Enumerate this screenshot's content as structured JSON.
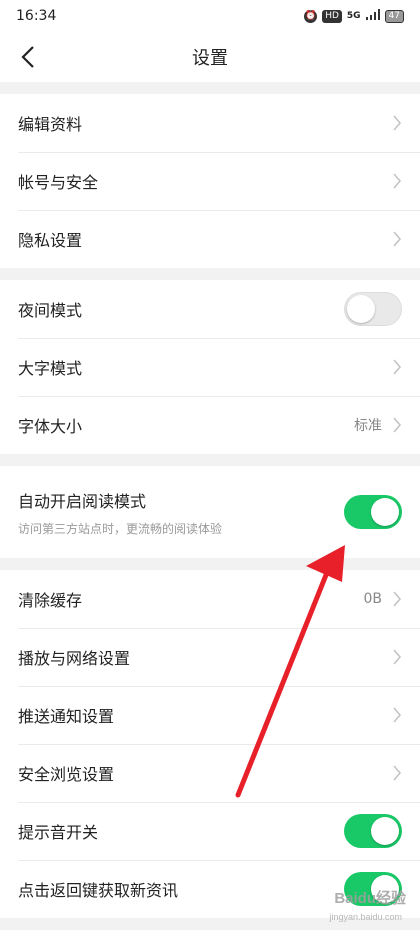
{
  "status_bar": {
    "time": "16:34",
    "hd": "HD",
    "network": "5G",
    "battery": "47"
  },
  "header": {
    "title": "设置"
  },
  "group1": [
    {
      "label": "编辑资料"
    },
    {
      "label": "帐号与安全"
    },
    {
      "label": "隐私设置"
    }
  ],
  "group2": {
    "night_mode": {
      "label": "夜间模式",
      "enabled": false
    },
    "large_font_mode": {
      "label": "大字模式"
    },
    "font_size": {
      "label": "字体大小",
      "value": "标准"
    }
  },
  "group3": {
    "auto_reading_mode": {
      "label": "自动开启阅读模式",
      "description": "访问第三方站点时，更流畅的阅读体验",
      "enabled": true
    }
  },
  "group4": {
    "clear_cache": {
      "label": "清除缓存",
      "value": "0B"
    },
    "playback_network": {
      "label": "播放与网络设置"
    },
    "push_notifications": {
      "label": "推送通知设置"
    },
    "safe_browsing": {
      "label": "安全浏览设置"
    },
    "sound_toggle": {
      "label": "提示音开关",
      "enabled": true
    },
    "back_refresh": {
      "label": "点击返回键获取新资讯",
      "enabled": true
    }
  },
  "watermark": {
    "text": "Baidu经验",
    "sub": "jingyan.baidu.com"
  },
  "annotation_color": "#e8202a",
  "accent_color": "#19c867"
}
